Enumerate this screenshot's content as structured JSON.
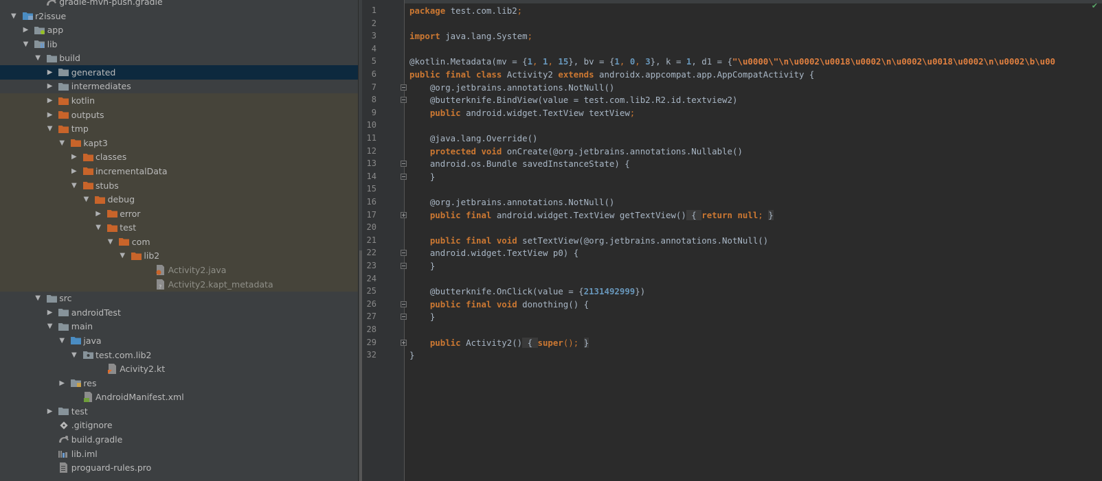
{
  "project_tree": {
    "rows": [
      {
        "label": "gradle-mvn-push.gradle",
        "depth": 2,
        "arrow": "none",
        "icon": "gradle-icon",
        "state": "normal"
      },
      {
        "label": "r2issue",
        "depth": 0,
        "arrow": "open",
        "icon": "module-folder-icon",
        "state": "normal"
      },
      {
        "label": "app",
        "depth": 1,
        "arrow": "closed",
        "icon": "android-module-icon",
        "state": "normal"
      },
      {
        "label": "lib",
        "depth": 1,
        "arrow": "open",
        "icon": "library-module-icon",
        "state": "normal"
      },
      {
        "label": "build",
        "depth": 2,
        "arrow": "open",
        "icon": "folder-icon",
        "state": "normal"
      },
      {
        "label": "generated",
        "depth": 3,
        "arrow": "closed",
        "icon": "folder-icon",
        "state": "selected"
      },
      {
        "label": "intermediates",
        "depth": 3,
        "arrow": "closed",
        "icon": "folder-icon",
        "state": "normal"
      },
      {
        "label": "kotlin",
        "depth": 3,
        "arrow": "closed",
        "icon": "excluded-folder-icon",
        "state": "highlighted"
      },
      {
        "label": "outputs",
        "depth": 3,
        "arrow": "closed",
        "icon": "excluded-folder-icon",
        "state": "highlighted"
      },
      {
        "label": "tmp",
        "depth": 3,
        "arrow": "open",
        "icon": "excluded-folder-icon",
        "state": "highlighted"
      },
      {
        "label": "kapt3",
        "depth": 4,
        "arrow": "open",
        "icon": "excluded-folder-icon",
        "state": "highlighted"
      },
      {
        "label": "classes",
        "depth": 5,
        "arrow": "closed",
        "icon": "excluded-folder-icon",
        "state": "highlighted"
      },
      {
        "label": "incrementalData",
        "depth": 5,
        "arrow": "closed",
        "icon": "excluded-folder-icon",
        "state": "highlighted"
      },
      {
        "label": "stubs",
        "depth": 5,
        "arrow": "open",
        "icon": "excluded-folder-icon",
        "state": "highlighted"
      },
      {
        "label": "debug",
        "depth": 6,
        "arrow": "open",
        "icon": "excluded-folder-icon",
        "state": "highlighted"
      },
      {
        "label": "error",
        "depth": 7,
        "arrow": "closed",
        "icon": "excluded-folder-icon",
        "state": "highlighted"
      },
      {
        "label": "test",
        "depth": 7,
        "arrow": "open",
        "icon": "excluded-folder-icon",
        "state": "highlighted"
      },
      {
        "label": "com",
        "depth": 8,
        "arrow": "open",
        "icon": "excluded-folder-icon",
        "state": "highlighted"
      },
      {
        "label": "lib2",
        "depth": 9,
        "arrow": "open",
        "icon": "excluded-folder-icon",
        "state": "highlighted"
      },
      {
        "label": "Activity2.java",
        "depth": 11,
        "arrow": "none",
        "icon": "java-file-icon",
        "state": "highlighted-dim"
      },
      {
        "label": "Activity2.kapt_metadata",
        "depth": 11,
        "arrow": "none",
        "icon": "unknown-file-icon",
        "state": "highlighted-dim"
      },
      {
        "label": "src",
        "depth": 2,
        "arrow": "open",
        "icon": "folder-icon",
        "state": "normal"
      },
      {
        "label": "androidTest",
        "depth": 3,
        "arrow": "closed",
        "icon": "folder-icon",
        "state": "normal"
      },
      {
        "label": "main",
        "depth": 3,
        "arrow": "open",
        "icon": "folder-icon",
        "state": "normal"
      },
      {
        "label": "java",
        "depth": 4,
        "arrow": "open",
        "icon": "source-folder-icon",
        "state": "normal"
      },
      {
        "label": "test.com.lib2",
        "depth": 5,
        "arrow": "open",
        "icon": "package-icon",
        "state": "normal"
      },
      {
        "label": "Acivity2.kt",
        "depth": 7,
        "arrow": "none",
        "icon": "kotlin-file-icon",
        "state": "normal"
      },
      {
        "label": "res",
        "depth": 4,
        "arrow": "closed",
        "icon": "resource-folder-icon",
        "state": "normal"
      },
      {
        "label": "AndroidManifest.xml",
        "depth": 5,
        "arrow": "none",
        "icon": "manifest-file-icon",
        "state": "normal"
      },
      {
        "label": "test",
        "depth": 3,
        "arrow": "closed",
        "icon": "folder-icon",
        "state": "normal"
      },
      {
        "label": ".gitignore",
        "depth": 3,
        "arrow": "none",
        "icon": "git-file-icon",
        "state": "normal"
      },
      {
        "label": "build.gradle",
        "depth": 3,
        "arrow": "none",
        "icon": "gradle-icon",
        "state": "normal"
      },
      {
        "label": "lib.iml",
        "depth": 3,
        "arrow": "none",
        "icon": "iml-file-icon",
        "state": "normal"
      },
      {
        "label": "proguard-rules.pro",
        "depth": 3,
        "arrow": "none",
        "icon": "text-file-icon",
        "state": "normal"
      }
    ]
  },
  "editor": {
    "lines": [
      {
        "number": "1",
        "fold": "",
        "tokens": [
          {
            "t": "package ",
            "c": "kw"
          },
          {
            "t": "test.com.lib2",
            "c": ""
          },
          {
            "t": ";",
            "c": "punct"
          }
        ]
      },
      {
        "number": "2",
        "fold": "",
        "tokens": []
      },
      {
        "number": "3",
        "fold": "",
        "tokens": [
          {
            "t": "import ",
            "c": "kw"
          },
          {
            "t": "java.lang.System",
            "c": ""
          },
          {
            "t": ";",
            "c": "punct"
          }
        ]
      },
      {
        "number": "4",
        "fold": "",
        "tokens": []
      },
      {
        "number": "5",
        "fold": "",
        "tokens": [
          {
            "t": "@kotlin.Metadata(mv = {",
            "c": ""
          },
          {
            "t": "1",
            "c": "num"
          },
          {
            "t": ", ",
            "c": "punct"
          },
          {
            "t": "1",
            "c": "num"
          },
          {
            "t": ", ",
            "c": "punct"
          },
          {
            "t": "15",
            "c": "num"
          },
          {
            "t": "}, bv = {",
            "c": ""
          },
          {
            "t": "1",
            "c": "num"
          },
          {
            "t": ", ",
            "c": "punct"
          },
          {
            "t": "0",
            "c": "num"
          },
          {
            "t": ", ",
            "c": "punct"
          },
          {
            "t": "3",
            "c": "num"
          },
          {
            "t": "}, k = ",
            "c": ""
          },
          {
            "t": "1",
            "c": "num"
          },
          {
            "t": ", d1 = {",
            "c": ""
          },
          {
            "t": "\"\\u0000\\\"\\n\\u0002\\u0018\\u0002\\n\\u0002\\u0018\\u0002\\n\\u0002\\b\\u00",
            "c": "str"
          }
        ]
      },
      {
        "number": "6",
        "fold": "",
        "tokens": [
          {
            "t": "public final class ",
            "c": "kw"
          },
          {
            "t": "Activity2 ",
            "c": ""
          },
          {
            "t": "extends ",
            "c": "kw"
          },
          {
            "t": "androidx.appcompat.app.AppCompatActivity {",
            "c": ""
          }
        ]
      },
      {
        "number": "7",
        "fold": "minus",
        "tokens": [
          {
            "t": "    @org.jetbrains.annotations.NotNull()",
            "c": ""
          }
        ]
      },
      {
        "number": "8",
        "fold": "minus",
        "tokens": [
          {
            "t": "    @butterknife.BindView(value = test.com.lib2.R2.id.textview2)",
            "c": ""
          }
        ]
      },
      {
        "number": "9",
        "fold": "",
        "tokens": [
          {
            "t": "    ",
            "c": ""
          },
          {
            "t": "public ",
            "c": "kw"
          },
          {
            "t": "android.widget.TextView textView",
            "c": ""
          },
          {
            "t": ";",
            "c": "punct"
          }
        ]
      },
      {
        "number": "10",
        "fold": "",
        "tokens": []
      },
      {
        "number": "11",
        "fold": "",
        "tokens": [
          {
            "t": "    @java.lang.Override()",
            "c": ""
          }
        ]
      },
      {
        "number": "12",
        "fold": "",
        "tokens": [
          {
            "t": "    ",
            "c": ""
          },
          {
            "t": "protected void ",
            "c": "kw"
          },
          {
            "t": "onCreate(@org.jetbrains.annotations.Nullable()",
            "c": ""
          }
        ]
      },
      {
        "number": "13",
        "fold": "minus",
        "tokens": [
          {
            "t": "    android.os.Bundle savedInstanceState) {",
            "c": ""
          }
        ]
      },
      {
        "number": "14",
        "fold": "minus",
        "tokens": [
          {
            "t": "    }",
            "c": ""
          }
        ]
      },
      {
        "number": "15",
        "fold": "",
        "tokens": []
      },
      {
        "number": "16",
        "fold": "",
        "tokens": [
          {
            "t": "    @org.jetbrains.annotations.NotNull()",
            "c": ""
          }
        ]
      },
      {
        "number": "17",
        "fold": "plus",
        "tokens": [
          {
            "t": "    ",
            "c": ""
          },
          {
            "t": "public final ",
            "c": "kw"
          },
          {
            "t": "android.widget.TextView getTextView()",
            "c": ""
          },
          {
            "t": " { ",
            "c": "fold"
          },
          {
            "t": "return null",
            "c": "kw"
          },
          {
            "t": "; ",
            "c": "punct"
          },
          {
            "t": "}",
            "c": "fold"
          }
        ]
      },
      {
        "number": "20",
        "fold": "",
        "tokens": []
      },
      {
        "number": "21",
        "fold": "",
        "tokens": [
          {
            "t": "    ",
            "c": ""
          },
          {
            "t": "public final void ",
            "c": "kw"
          },
          {
            "t": "setTextView(@org.jetbrains.annotations.NotNull()",
            "c": ""
          }
        ]
      },
      {
        "number": "22",
        "fold": "minus",
        "tokens": [
          {
            "t": "    android.widget.TextView p0) {",
            "c": ""
          }
        ]
      },
      {
        "number": "23",
        "fold": "minus",
        "tokens": [
          {
            "t": "    }",
            "c": ""
          }
        ]
      },
      {
        "number": "24",
        "fold": "",
        "tokens": []
      },
      {
        "number": "25",
        "fold": "",
        "tokens": [
          {
            "t": "    @butterknife.OnClick(value = {",
            "c": ""
          },
          {
            "t": "2131492999",
            "c": "num"
          },
          {
            "t": "})",
            "c": ""
          }
        ]
      },
      {
        "number": "26",
        "fold": "minus",
        "tokens": [
          {
            "t": "    ",
            "c": ""
          },
          {
            "t": "public final void ",
            "c": "kw"
          },
          {
            "t": "donothing() {",
            "c": ""
          }
        ]
      },
      {
        "number": "27",
        "fold": "minus",
        "tokens": [
          {
            "t": "    }",
            "c": ""
          }
        ]
      },
      {
        "number": "28",
        "fold": "",
        "tokens": []
      },
      {
        "number": "29",
        "fold": "plus",
        "tokens": [
          {
            "t": "    ",
            "c": ""
          },
          {
            "t": "public ",
            "c": "kw"
          },
          {
            "t": "Activity2()",
            "c": ""
          },
          {
            "t": " { ",
            "c": "fold"
          },
          {
            "t": "super",
            "c": "kw"
          },
          {
            "t": "(); ",
            "c": "punct"
          },
          {
            "t": "}",
            "c": "fold"
          }
        ]
      },
      {
        "number": "32",
        "fold": "",
        "tokens": [
          {
            "t": "}",
            "c": ""
          }
        ]
      }
    ]
  },
  "colors": {
    "panel_bg": "#3c3f41",
    "editor_bg": "#2b2b2b",
    "selection": "#0d293e",
    "excluded_highlight": "#46443a",
    "keyword": "#cc7832",
    "number": "#6897bb",
    "string": "#e08040",
    "folder_plain": "#87939a",
    "folder_excluded": "#c8642a",
    "folder_source": "#4a8cc2"
  }
}
